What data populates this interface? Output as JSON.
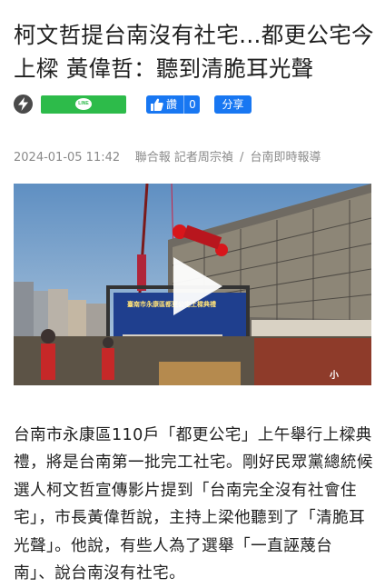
{
  "article": {
    "headline": "柯文哲提台南沒有社宅…都更公宅今上樑 黃偉哲：聽到清脆耳光聲",
    "date": "2024-01-05 11:42",
    "source": "聯合報",
    "reporter": "記者周宗禎",
    "category": "台南即時報導",
    "separator": "/",
    "body": "台南市永康區110戶「都更公宅」上午舉行上樑典禮，將是台南第一批完工社宅。剛好民眾黨總統候選人柯文哲宣傳影片提到「台南完全沒有社會住宅」，市長黃偉哲說，主持上梁他聽到了「清脆耳光聲」。他說，有些人為了選舉「一直誣蔑台南」、說台南沒有社宅。"
  },
  "share": {
    "line_label": "LINE",
    "fb_label": "讚",
    "fb_count": "0",
    "share_label": "分享"
  },
  "video": {
    "banner_text": "臺南市永康區都更公宅上樑典禮",
    "logo": "小"
  },
  "icons": {
    "flash": "flash-icon",
    "thumb": "thumbs-up-icon",
    "play": "play-icon"
  },
  "colors": {
    "line_green": "#2dbb4a",
    "facebook_blue": "#1877f2",
    "meta_gray": "#8a8a8a"
  }
}
